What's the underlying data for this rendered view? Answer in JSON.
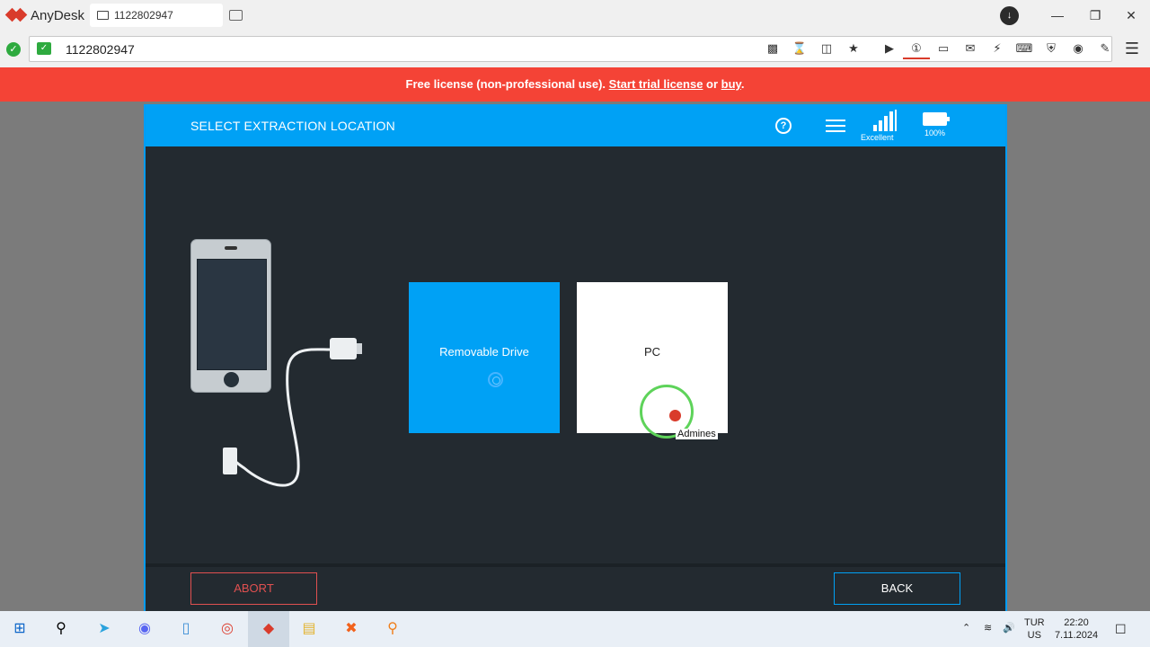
{
  "titlebar": {
    "app_name": "AnyDesk",
    "session_tab": "1122802947"
  },
  "address": {
    "value": "1122802947"
  },
  "banner": {
    "prefix": "Free license (non-professional use). ",
    "trial_link": "Start trial license",
    "or": " or ",
    "buy_link": "buy",
    "suffix": "."
  },
  "app": {
    "title": "SELECT EXTRACTION LOCATION",
    "signal_label": "Excellent",
    "battery_label": "100%",
    "options": {
      "removable": "Removable Drive",
      "pc": "PC"
    },
    "buttons": {
      "abort": "ABORT",
      "back": "BACK"
    }
  },
  "cursor": {
    "label": "Admines"
  },
  "taskbar": {
    "lang_top": "TUR",
    "lang_bottom": "US",
    "time": "22:20",
    "date": "7.11.2024"
  },
  "colors": {
    "accent": "#00a1f5",
    "banner": "#f44336",
    "app_bg": "#232a30",
    "anydesk_red": "#d93b2b"
  }
}
